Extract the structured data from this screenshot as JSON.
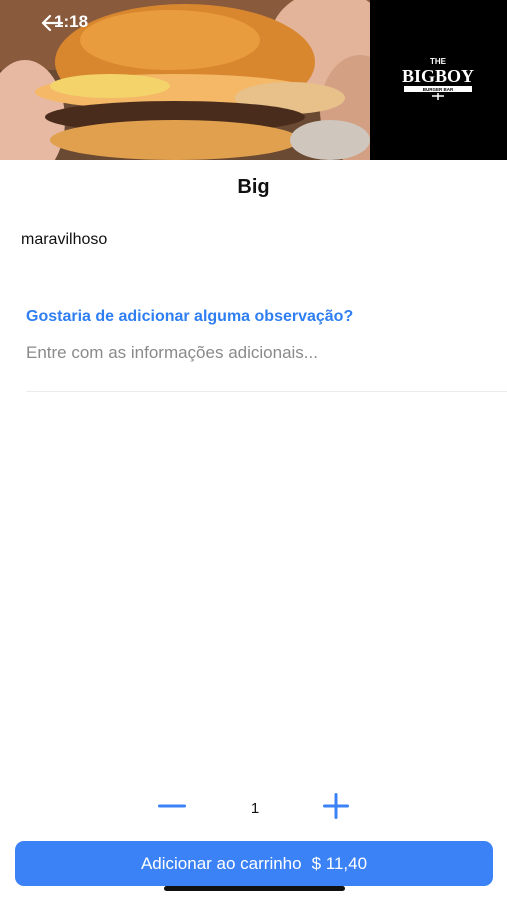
{
  "status": {
    "time": "1:18"
  },
  "hero": {
    "logo_top": "THE",
    "logo_main": "BIGBOY",
    "logo_sub": "BURGER BAR"
  },
  "product": {
    "title": "Big",
    "description": "maravilhoso"
  },
  "notes": {
    "label": "Gostaria de adicionar alguma observação?",
    "placeholder": "Entre com as informações adicionais..."
  },
  "quantity": {
    "value": "1"
  },
  "cart": {
    "label": "Adicionar ao carrinho",
    "price": "$ 11,40"
  },
  "colors": {
    "accent": "#3b82f6",
    "link": "#2f7ff2"
  },
  "icons": {
    "back": "arrow-left-icon",
    "minus": "minus-icon",
    "plus": "plus-icon"
  }
}
